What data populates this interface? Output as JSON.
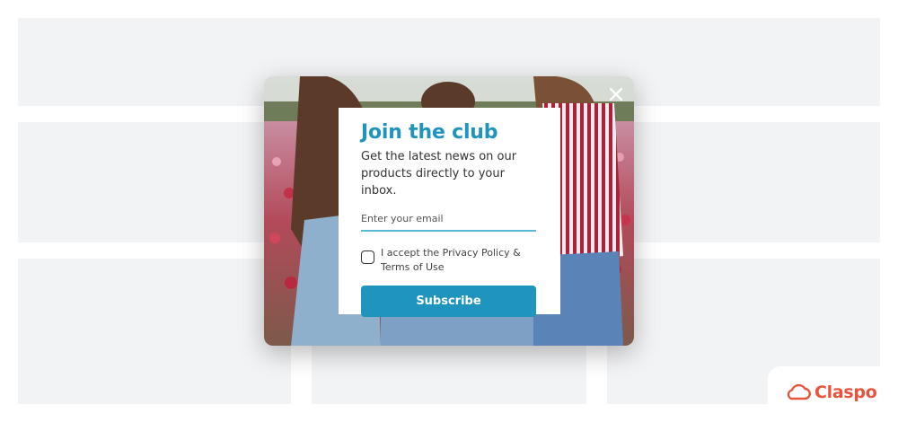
{
  "popup": {
    "title": "Join the club",
    "subtitle": "Get the latest news on our products directly to your inbox.",
    "email_placeholder": "Enter your email",
    "consent_label": "I accept the Privacy Policy & Terms of Use",
    "subscribe_label": "Subscribe",
    "close_icon": "close-icon",
    "accent_color": "#1f94bd"
  },
  "brand": {
    "name": "Claspo",
    "icon": "cloud-icon",
    "color": "#e8553e"
  }
}
